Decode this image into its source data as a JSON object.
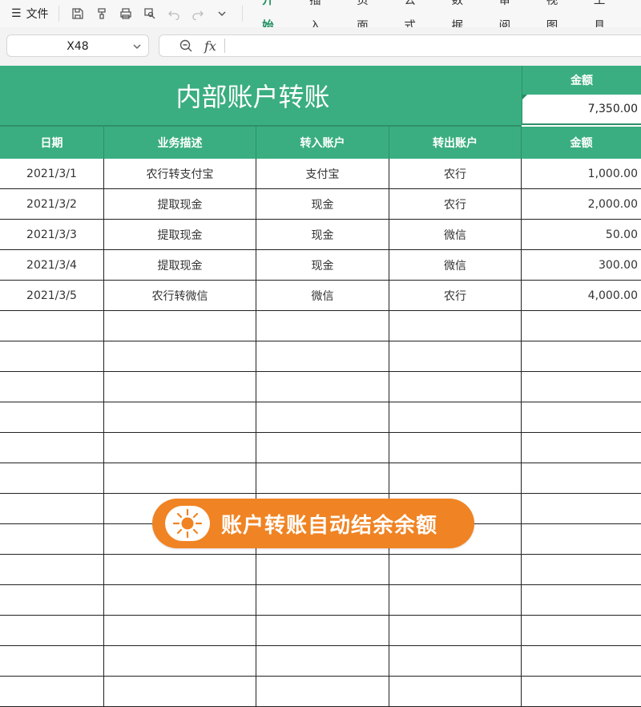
{
  "toolbar": {
    "file_label": "文件",
    "tabs": [
      "开始",
      "插入",
      "页面",
      "公式",
      "数据",
      "审阅",
      "视图",
      "工具"
    ],
    "active_tab": "开始"
  },
  "formula_bar": {
    "cell_ref": "X48",
    "fx_label": "fx",
    "content": ""
  },
  "sheet": {
    "title": "内部账户转账",
    "amount_label": "金额",
    "amount_total": "7,350.00",
    "columns": [
      "日期",
      "业务描述",
      "转入账户",
      "转出账户",
      "金额"
    ],
    "rows": [
      [
        "2021/3/1",
        "农行转支付宝",
        "支付宝",
        "农行",
        "1,000.00"
      ],
      [
        "2021/3/2",
        "提取现金",
        "现金",
        "农行",
        "2,000.00"
      ],
      [
        "2021/3/3",
        "提取现金",
        "现金",
        "微信",
        "50.00"
      ],
      [
        "2021/3/4",
        "提取现金",
        "现金",
        "微信",
        "300.00"
      ],
      [
        "2021/3/5",
        "农行转微信",
        "微信",
        "农行",
        "4,000.00"
      ],
      [
        "",
        "",
        "",
        "",
        ""
      ],
      [
        "",
        "",
        "",
        "",
        ""
      ],
      [
        "",
        "",
        "",
        "",
        ""
      ],
      [
        "",
        "",
        "",
        "",
        ""
      ],
      [
        "",
        "",
        "",
        "",
        ""
      ],
      [
        "",
        "",
        "",
        "",
        ""
      ],
      [
        "",
        "",
        "",
        "",
        ""
      ],
      [
        "",
        "",
        "",
        "",
        ""
      ],
      [
        "",
        "",
        "",
        "",
        ""
      ],
      [
        "",
        "",
        "",
        "",
        ""
      ],
      [
        "",
        "",
        "",
        "",
        ""
      ],
      [
        "",
        "",
        "",
        "",
        ""
      ],
      [
        "",
        "",
        "",
        "",
        ""
      ]
    ]
  },
  "banner": {
    "text": "账户转账自动结余余额"
  },
  "colors": {
    "header_green": "#3aae80",
    "accent_green": "#1f8f5f",
    "banner_orange": "#f08323"
  }
}
